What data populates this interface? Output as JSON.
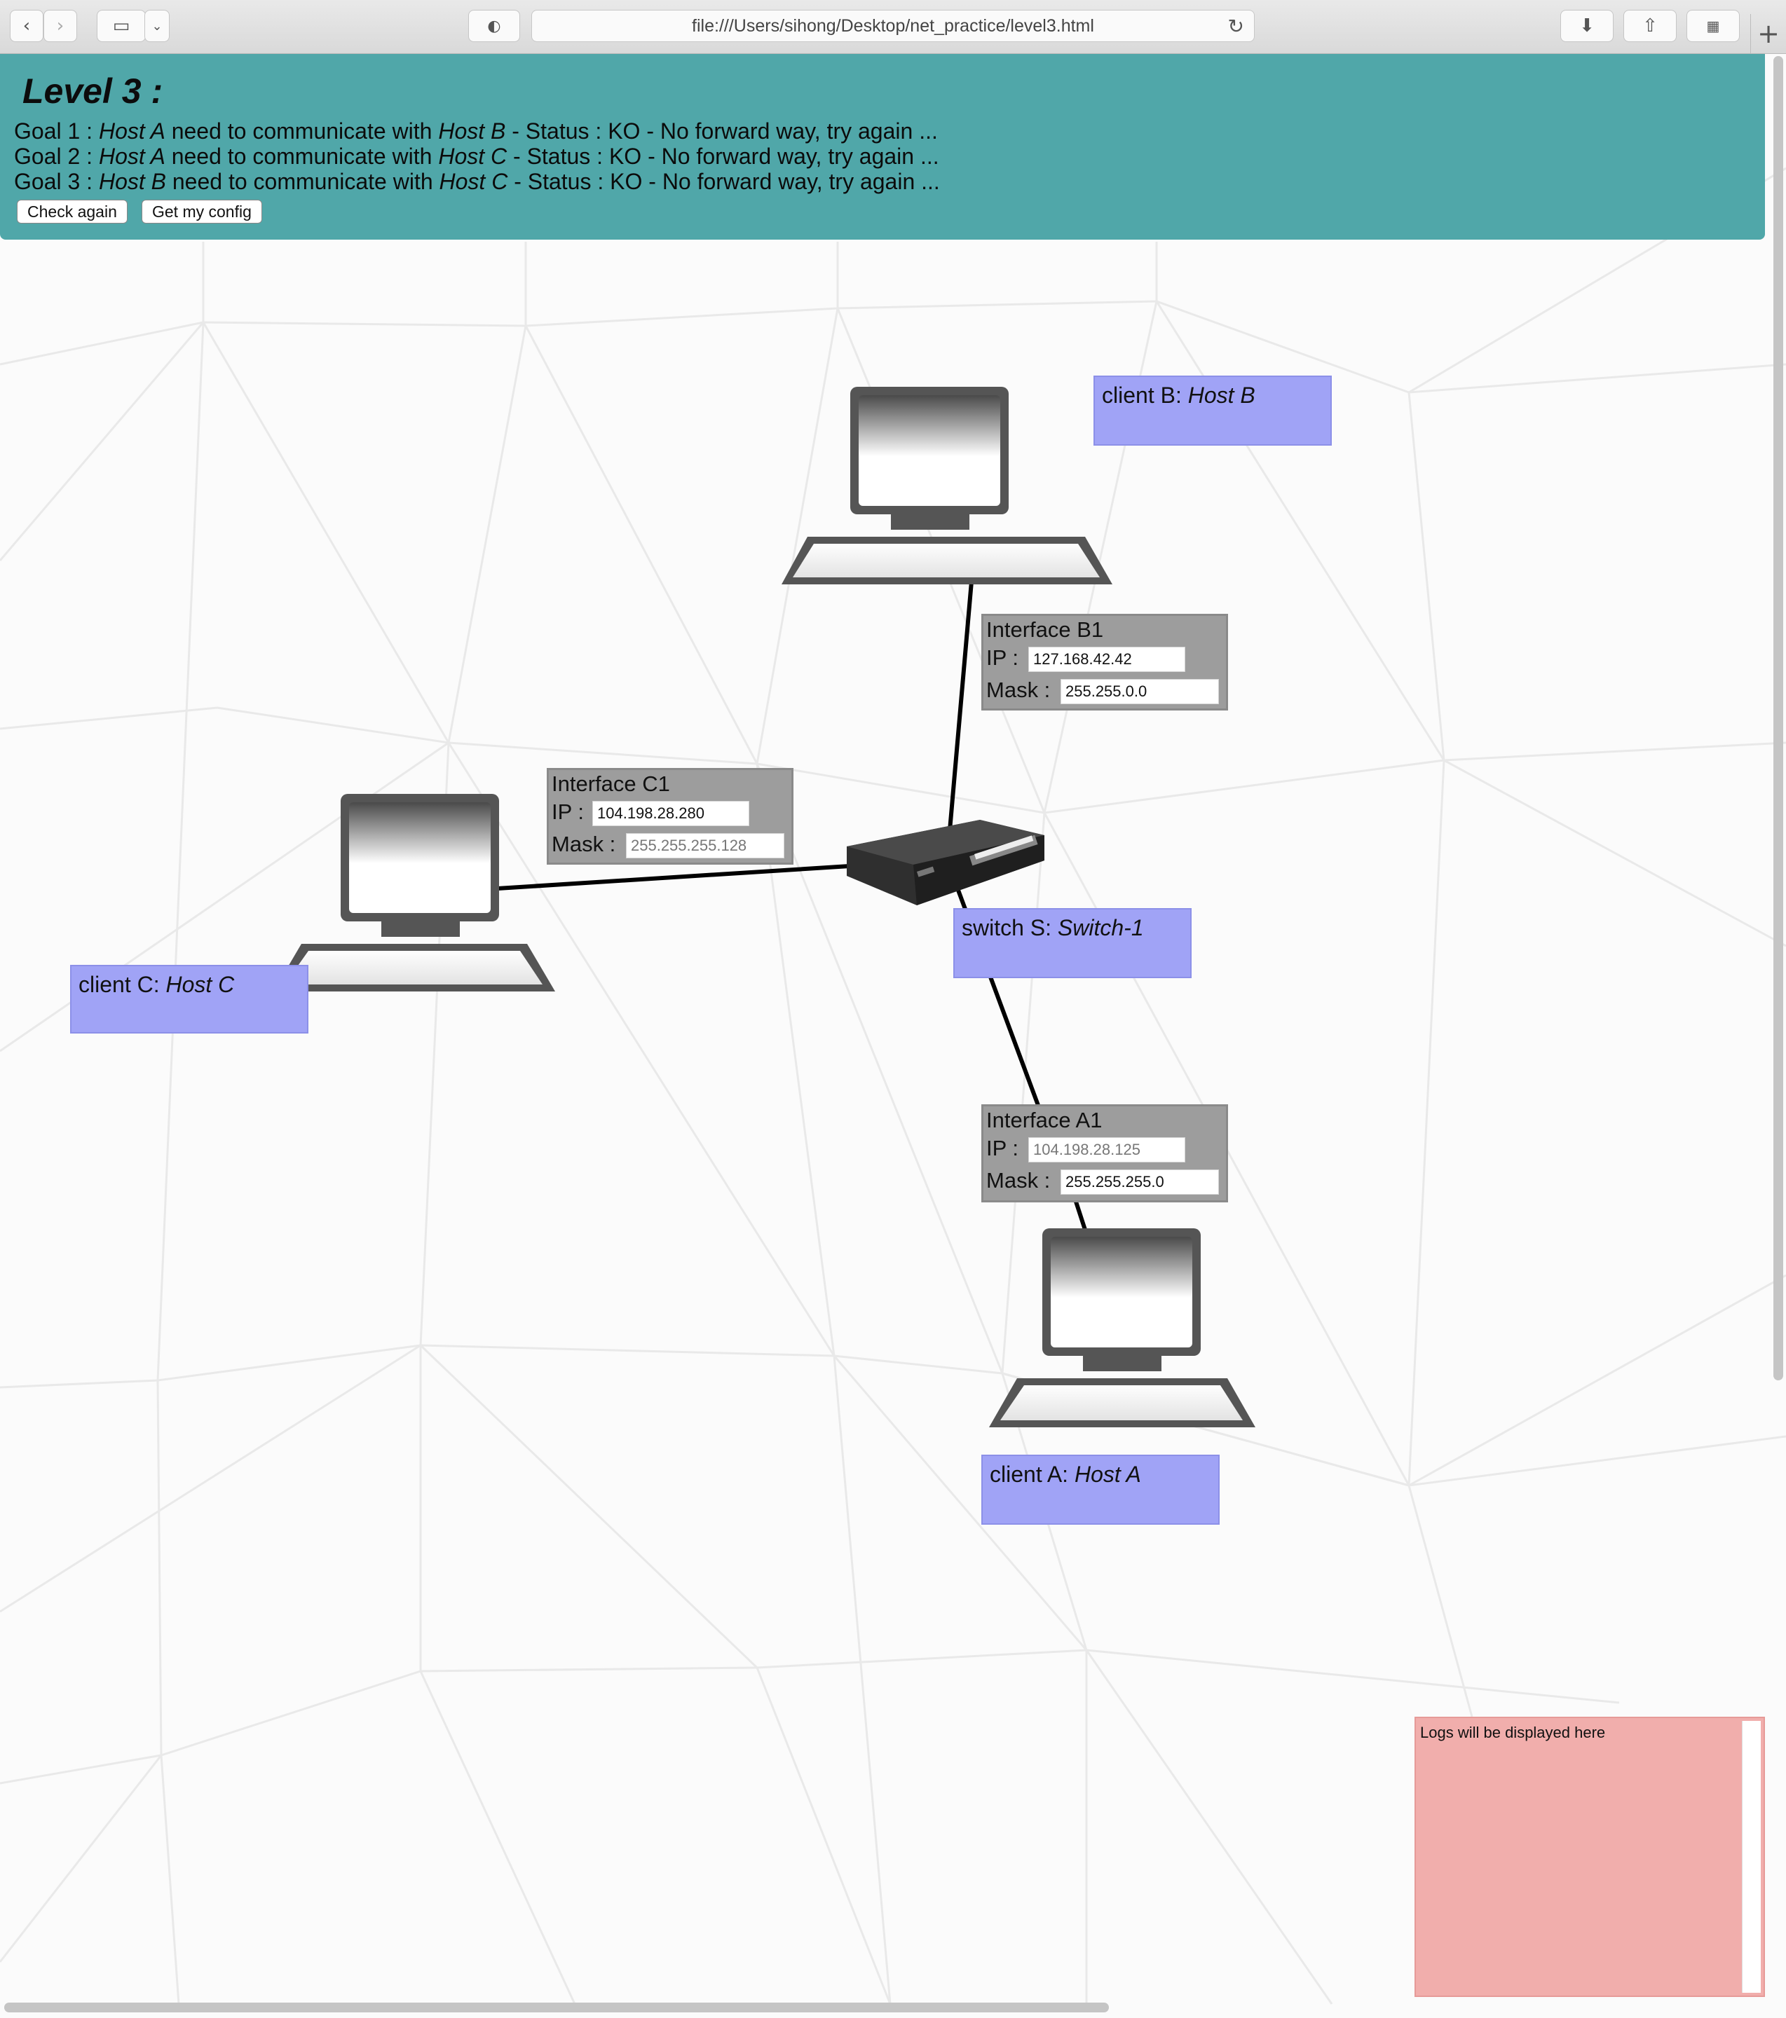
{
  "browser": {
    "url": "file:///Users/sihong/Desktop/net_practice/level3.html",
    "new_tab": "+"
  },
  "header": {
    "title": "Level 3 :",
    "goals": [
      {
        "prefix": "Goal 1 : ",
        "host1": "Host A",
        "mid": " need to communicate with ",
        "host2": "Host B",
        "status": " - Status : KO - No forward way, try again ..."
      },
      {
        "prefix": "Goal 2 : ",
        "host1": "Host A",
        "mid": " need to communicate with ",
        "host2": "Host C",
        "status": " - Status : KO - No forward way, try again ..."
      },
      {
        "prefix": "Goal 3 : ",
        "host1": "Host B",
        "mid": " need to communicate with ",
        "host2": "Host C",
        "status": " - Status : KO - No forward way, try again ..."
      }
    ],
    "buttons": {
      "check": "Check again",
      "config": "Get my config"
    }
  },
  "nodes": {
    "client_b": {
      "prefix": "client B: ",
      "name": "Host B"
    },
    "client_c": {
      "prefix": "client C: ",
      "name": "Host C"
    },
    "client_a": {
      "prefix": "client A: ",
      "name": "Host A"
    },
    "switch_s": {
      "prefix": "switch S: ",
      "name": "Switch-1"
    }
  },
  "interfaces": {
    "b1": {
      "title": "Interface B1",
      "ip_label": "IP :",
      "mask_label": "Mask :",
      "ip": "127.168.42.42",
      "mask": "255.255.0.0"
    },
    "c1": {
      "title": "Interface C1",
      "ip_label": "IP :",
      "mask_label": "Mask :",
      "ip": "104.198.28.280",
      "mask_placeholder": "255.255.255.128"
    },
    "a1": {
      "title": "Interface A1",
      "ip_label": "IP :",
      "mask_label": "Mask :",
      "ip_placeholder": "104.198.28.125",
      "mask": "255.255.255.0"
    }
  },
  "logs": {
    "text": "Logs will be displayed here"
  },
  "colors": {
    "header": "#50a7a9",
    "label": "#a0a3f6",
    "interface": "#9d9d9d",
    "logs": "#f1aeac"
  }
}
